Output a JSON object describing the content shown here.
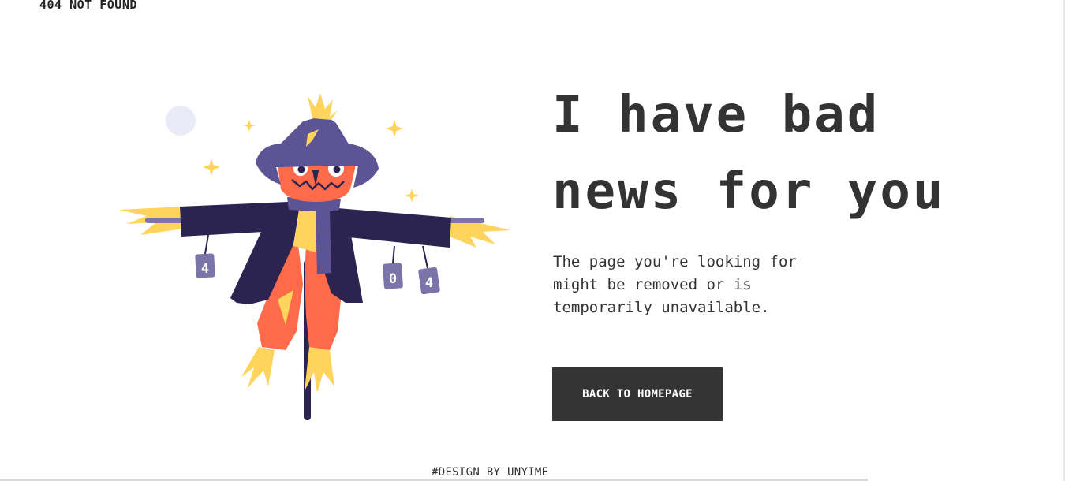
{
  "header": {
    "status_label": "404 NOT FOUND"
  },
  "hero": {
    "headline": "I have bad news for you",
    "description": "The page you're looking for might be removed or is temporarily unavailable.",
    "back_button_label": "BACK TO HOMEPAGE"
  },
  "illustration": {
    "can_left": "4",
    "can_middle": "0",
    "can_right": "4"
  },
  "footer": {
    "credit": "#DESIGN BY UNYIME"
  },
  "colors": {
    "text": "#333333",
    "button_bg": "#333333",
    "button_text": "#ffffff",
    "hat": "#5c5494",
    "coat": "#2b2350",
    "face": "#ff6b4a",
    "straw": "#ffd45c",
    "can": "#7a74a8"
  }
}
